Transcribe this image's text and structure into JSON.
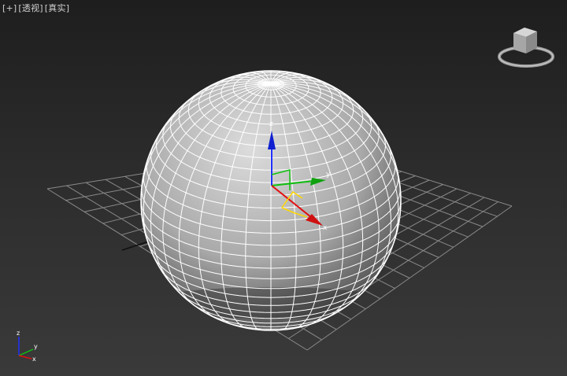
{
  "viewport": {
    "label": {
      "menu": "[+]",
      "view": "[透视]",
      "shading": "[真实]"
    }
  },
  "gizmo": {
    "x_axis_label": "x",
    "y_axis_label": "y",
    "z_axis_label": "z"
  },
  "axis_tripod": {
    "x_label": "x",
    "y_label": "y",
    "z_label": "z"
  },
  "colors": {
    "x_axis": "#d01010",
    "y_axis": "#10a010",
    "z_axis": "#1020d0",
    "grid": "#8a8a8a",
    "wireframe": "#ffffff",
    "selected": "#ffd800"
  },
  "icons": {
    "viewcube": "viewcube-icon",
    "axis_tripod": "axis-tripod-icon"
  }
}
